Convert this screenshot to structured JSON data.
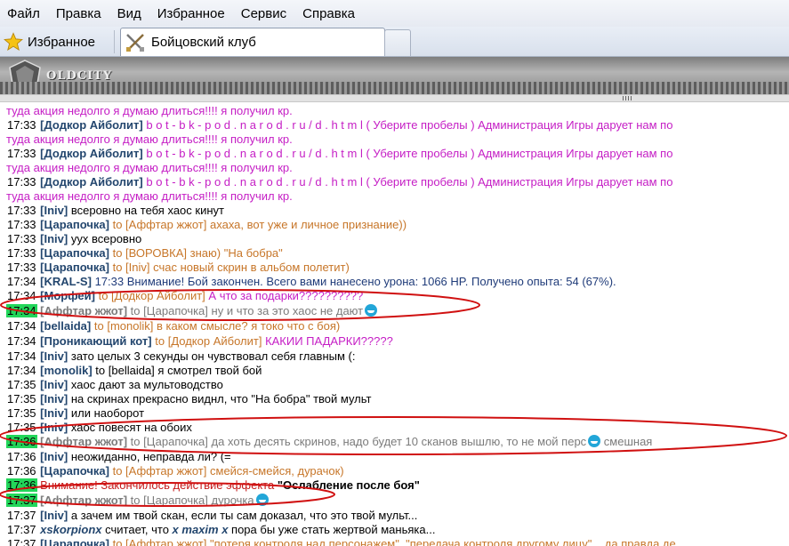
{
  "menu": [
    "Файл",
    "Правка",
    "Вид",
    "Избранное",
    "Сервис",
    "Справка"
  ],
  "toolbar": {
    "favorites": "Избранное"
  },
  "tab": {
    "title": "Бойцовский клуб"
  },
  "banner": {
    "logo": "OLDCITY"
  },
  "icons": {
    "favorites": "star-icon",
    "tab": "crossed-swords-icon",
    "smiley": "smiley-icon"
  },
  "colors": {
    "time_highlight": "#22d65a",
    "nick": "#23466e",
    "to_target": "#c77629",
    "system_pink": "#c51ec5",
    "annotation": "#d01010"
  },
  "messages": [
    {
      "time": "",
      "nick": "",
      "to": "",
      "text": "туда акция недолго я думаю длиться!!!! я получил кр.",
      "tcls": "",
      "ncls": "",
      "ocls": "",
      "mcls": "pink"
    },
    {
      "time": "17:33",
      "nick": "[Додкор Айболит]",
      "to": "",
      "text": "b o t - b k - p o d . n a r o d . r u / d . h t m l ( Уберите пробелы ) Администрация Игры дарует нам по",
      "tcls": "",
      "ncls": "",
      "ocls": "",
      "mcls": "pink"
    },
    {
      "time": "",
      "nick": "",
      "to": "",
      "text": "туда акция недолго я думаю длиться!!!! я получил кр.",
      "tcls": "",
      "ncls": "",
      "ocls": "",
      "mcls": "pink"
    },
    {
      "time": "17:33",
      "nick": "[Додкор Айболит]",
      "to": "",
      "text": "b o t - b k - p o d . n a r o d . r u / d . h t m l ( Уберите пробелы ) Администрация Игры дарует нам по",
      "tcls": "",
      "ncls": "",
      "ocls": "",
      "mcls": "pink"
    },
    {
      "time": "",
      "nick": "",
      "to": "",
      "text": "туда акция недолго я думаю длиться!!!! я получил кр.",
      "tcls": "",
      "ncls": "",
      "ocls": "",
      "mcls": "pink"
    },
    {
      "time": "17:33",
      "nick": "[Додкор Айболит]",
      "to": "",
      "text": "b o t - b k - p o d . n a r o d . r u / d . h t m l ( Уберите пробелы ) Администрация Игры дарует нам по",
      "tcls": "",
      "ncls": "",
      "ocls": "",
      "mcls": "pink"
    },
    {
      "time": "",
      "nick": "",
      "to": "",
      "text": "туда акция недолго я думаю длиться!!!! я получил кр.",
      "tcls": "",
      "ncls": "",
      "ocls": "",
      "mcls": "pink"
    },
    {
      "time": "17:33",
      "nick": "[Iniv]",
      "to": "",
      "text": "всеровно на тебя хаос кинут",
      "tcls": "",
      "ncls": "",
      "ocls": "",
      "mcls": ""
    },
    {
      "time": "17:33",
      "nick": "[Царапочка]",
      "to": "to [Аффтар жжот]",
      "text": "ахаха, вот уже и личное признание))",
      "tcls": "",
      "ncls": "",
      "ocls": "",
      "mcls": "orange"
    },
    {
      "time": "17:33",
      "nick": "[Iniv]",
      "to": "",
      "text": "уух всеровно",
      "tcls": "",
      "ncls": "",
      "ocls": "",
      "mcls": ""
    },
    {
      "time": "17:33",
      "nick": "[Царапочка]",
      "to": "to [ВОРОВКА]",
      "text": "знаю) \"На бобра\"",
      "tcls": "",
      "ncls": "",
      "ocls": "",
      "mcls": "orange"
    },
    {
      "time": "17:33",
      "nick": "[Царапочка]",
      "to": "to [Iniv]",
      "text": "счас новый скрин в альбом полетит)",
      "tcls": "",
      "ncls": "",
      "ocls": "",
      "mcls": "orange"
    },
    {
      "time": "17:34",
      "nick": "[KRAL-S]",
      "to": "",
      "text": "17:33 Внимание! Бой закончен. Всего вами нанесено урона: 1066 HP. Получено опыта: 54 (67%).",
      "tcls": "",
      "ncls": "",
      "ocls": "",
      "mcls": "navy"
    },
    {
      "time": "17:34",
      "nick": "[Морфей]",
      "to": "to [Додкор Айболит]",
      "text": "А что за подарки??????????",
      "tcls": "",
      "ncls": "",
      "ocls": "",
      "mcls": "pink"
    },
    {
      "time": "17:34",
      "nick": "[Аффтар жжот]",
      "to": "to [Царапочка]",
      "text": "ну и что за это хаос не дают",
      "tcls": "g",
      "ncls": "gray",
      "ocls": "gray",
      "mcls": "gray",
      "smiley": true
    },
    {
      "time": "17:34",
      "nick": "[bellaida]",
      "to": "to [monolik]",
      "text": "в каком смысле? я токо что с боя)",
      "tcls": "",
      "ncls": "",
      "ocls": "",
      "mcls": "orange"
    },
    {
      "time": "17:34",
      "nick": "[Проникающий кот]",
      "to": "to [Додкор Айболит]",
      "text": "КАКИИ ПАДАРКИ?????",
      "tcls": "",
      "ncls": "",
      "ocls": "",
      "mcls": "pink"
    },
    {
      "time": "17:34",
      "nick": "[Iniv]",
      "to": "",
      "text": "зато целых 3 секунды он чувствовал себя главным (:",
      "tcls": "",
      "ncls": "",
      "ocls": "",
      "mcls": ""
    },
    {
      "time": "17:34",
      "nick": "[monolik]",
      "to": "to [bellaida]",
      "text": "я смотрел твой бой",
      "tcls": "",
      "ncls": "",
      "ocls": "",
      "mcls": "",
      "tocls": "m"
    },
    {
      "time": "17:35",
      "nick": "[Iniv]",
      "to": "",
      "text": "хаос дают за мультоводство",
      "tcls": "",
      "ncls": "",
      "ocls": "",
      "mcls": ""
    },
    {
      "time": "17:35",
      "nick": "[Iniv]",
      "to": "",
      "text": "на скринах прекрасно виднл, что \"На бобра\" твой мульт",
      "tcls": "",
      "ncls": "",
      "ocls": "",
      "mcls": ""
    },
    {
      "time": "17:35",
      "nick": "[Iniv]",
      "to": "",
      "text": "или наоборот",
      "tcls": "",
      "ncls": "",
      "ocls": "",
      "mcls": ""
    },
    {
      "time": "17:35",
      "nick": "[Iniv]",
      "to": "",
      "text": "хаос повесят на обоих",
      "tcls": "",
      "ncls": "",
      "ocls": "",
      "mcls": ""
    },
    {
      "time": "17:36",
      "nick": "[Аффтар жжот]",
      "to": "to [Царапочка]",
      "text": "да хоть десять скринов, надо будет 10 сканов вышлю, то не мой перс",
      "tcls": "g",
      "ncls": "gray",
      "ocls": "gray",
      "mcls": "gray",
      "smiley": true,
      "after": " смешная"
    },
    {
      "time": "17:36",
      "nick": "[Iniv]",
      "to": "",
      "text": "неожиданно, неправда ли? (=",
      "tcls": "",
      "ncls": "",
      "ocls": "",
      "mcls": ""
    },
    {
      "time": "17:36",
      "nick": "[Царапочка]",
      "to": "to [Аффтар жжот]",
      "text": "смейся-смейся, дурачок)",
      "tcls": "",
      "ncls": "",
      "ocls": "",
      "mcls": "orange"
    },
    {
      "time": "17:36",
      "nick": "",
      "to": "",
      "text": "Внимание! Закончилось действие эффекта ",
      "tcls": "g",
      "ncls": "",
      "ocls": "",
      "mcls": "red",
      "bold": "\"Ослабление после боя\""
    },
    {
      "time": "17:37",
      "nick": "[Аффтар жжот]",
      "to": "to [Царапочка]",
      "text": "дурочка",
      "tcls": "g",
      "ncls": "gray",
      "ocls": "gray",
      "mcls": "gray",
      "smiley": true
    },
    {
      "time": "17:37",
      "nick": "[Iniv]",
      "to": "",
      "text": "а зачем им твой скан, если ты сам доказал, что это твой мульт...",
      "tcls": "",
      "ncls": "",
      "ocls": "",
      "mcls": ""
    },
    {
      "time": "17:37",
      "nick": "xskorpionx",
      "to": "",
      "text": "считает, что x maxim x пора бы уже стать жертвой маньяка...",
      "tcls": "",
      "ncls": "it",
      "ocls": "",
      "mcls": "",
      "emote": true
    },
    {
      "time": "17:37",
      "nick": "[Царапочка]",
      "to": "to [Аффтар жжот]",
      "text": "\"потеря контроля над персонажем\", \"передача контроля другому лицу\"... да правда де",
      "tcls": "",
      "ncls": "",
      "ocls": "",
      "mcls": "orange"
    }
  ]
}
